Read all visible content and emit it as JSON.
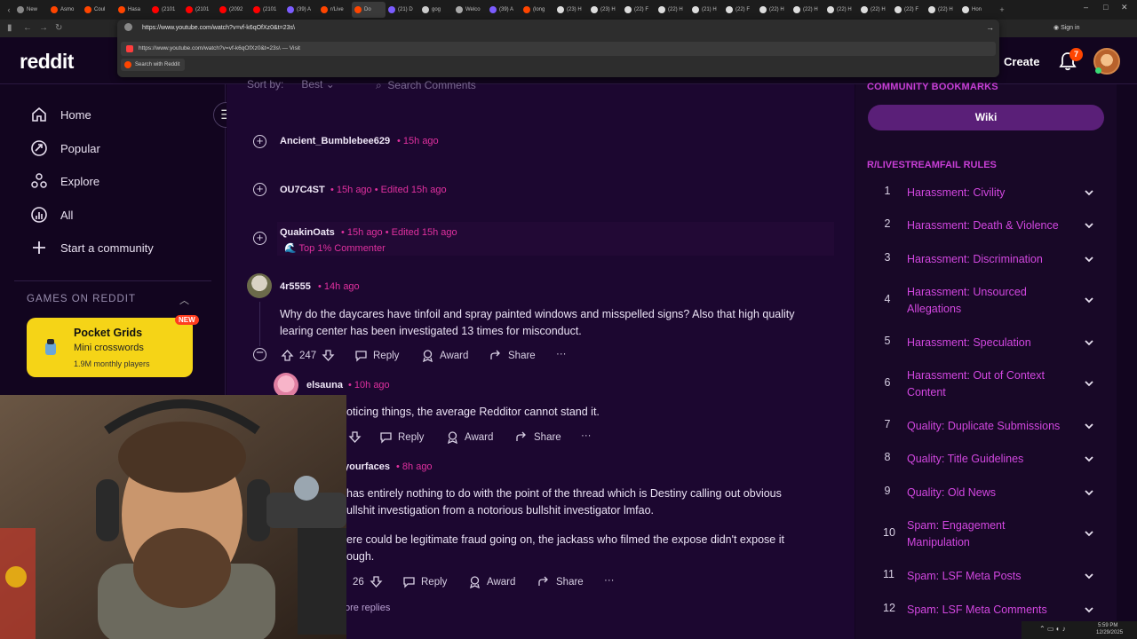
{
  "browser": {
    "tabs": [
      "New",
      "Asmo",
      "Coul",
      "Hasa",
      "(2101",
      "(2101",
      "(2092",
      "(2101",
      "(39) A",
      "r/Live",
      "Do",
      "(21) D",
      "gog",
      "Welco",
      "(39) A",
      "(long",
      "(23) H",
      "(23) H",
      "(22) F",
      "(22) H",
      "(21) H",
      "(22) F",
      "(22) H",
      "(22) H",
      "(22) H",
      "(22) H",
      "(22) F",
      "(22) H",
      "Hon"
    ],
    "active_tab_index": 10,
    "address": "https://www.youtube.com/watch?v=vf-k6qOfXz0&t=23s\\",
    "suggestion": "https://www.youtube.com/watch?v=vf-k6qOfXz0&t=23s\\ — Visit",
    "search_with": "Search with Reddit",
    "sign_in": "Sign in"
  },
  "header": {
    "logo": "reddit",
    "create": "Create",
    "notifications": "7"
  },
  "left_nav": {
    "items": [
      {
        "label": "Home",
        "icon": "home-icon"
      },
      {
        "label": "Popular",
        "icon": "popular-icon"
      },
      {
        "label": "Explore",
        "icon": "explore-icon"
      },
      {
        "label": "All",
        "icon": "all-icon"
      },
      {
        "label": "Start a community",
        "icon": "plus-icon"
      }
    ],
    "games_heading": "GAMES ON REDDIT",
    "game": {
      "badge": "NEW",
      "title": "Pocket Grids",
      "subtitle": "Mini crosswords",
      "players": "1.9M monthly players"
    }
  },
  "comments": {
    "sort_label": "Sort by:",
    "sort_value": "Best",
    "search_placeholder": "Search Comments",
    "items": [
      {
        "author": "Ancient_Bumblebee629",
        "meta": "• 15h ago"
      },
      {
        "author": "OU7C4ST",
        "meta": "• 15h ago • Edited 15h ago"
      },
      {
        "author": "QuakinOats",
        "meta": "• 15h ago • Edited 15h ago",
        "flair": "🌊 Top 1% Commenter"
      },
      {
        "author": "4r5555",
        "meta": "• 14h ago",
        "body": "Why do the daycares have tinfoil and spray painted windows and misspelled signs? Also that high quality learing center has been investigated 13 times for misconduct.",
        "votes": "247"
      },
      {
        "author": "elsauna",
        "meta": "• 10h ago",
        "body": "oticing things, the average Redditor cannot stand it."
      },
      {
        "author": "yourfaces",
        "meta": "• 8h ago",
        "body1": "has entirely nothing to do with the point of the thread which is Destiny calling out obvious",
        "body2": "ullshit investigation from a notorious bullshit investigator lmfao.",
        "body3": "ere could be legitimate fraud going on, the jackass who filmed the expose didn't expose it",
        "body4": "ough.",
        "votes": "26"
      }
    ],
    "actions": {
      "reply": "Reply",
      "award": "Award",
      "share": "Share",
      "more": "···"
    },
    "more_replies": "ore replies"
  },
  "right_sidebar": {
    "bookmarks_heading": "COMMUNITY BOOKMARKS",
    "wiki": "Wiki",
    "rules_heading": "R/LIVESTREAMFAIL RULES",
    "rules": [
      {
        "n": "1",
        "text": "Harassment: Civility"
      },
      {
        "n": "2",
        "text": "Harassment: Death & Violence"
      },
      {
        "n": "3",
        "text": "Harassment: Discrimination"
      },
      {
        "n": "4",
        "text": "Harassment: Unsourced Allegations"
      },
      {
        "n": "5",
        "text": "Harassment: Speculation"
      },
      {
        "n": "6",
        "text": "Harassment: Out of Context Content"
      },
      {
        "n": "7",
        "text": "Quality: Duplicate Submissions"
      },
      {
        "n": "8",
        "text": "Quality: Title Guidelines"
      },
      {
        "n": "9",
        "text": "Quality: Old News"
      },
      {
        "n": "10",
        "text": "Spam: Engagement Manipulation"
      },
      {
        "n": "11",
        "text": "Spam: LSF Meta Posts"
      },
      {
        "n": "12",
        "text": "Spam: LSF Meta Comments"
      }
    ]
  },
  "systray": {
    "time": "5:59 PM",
    "date": "12/29/2025"
  }
}
